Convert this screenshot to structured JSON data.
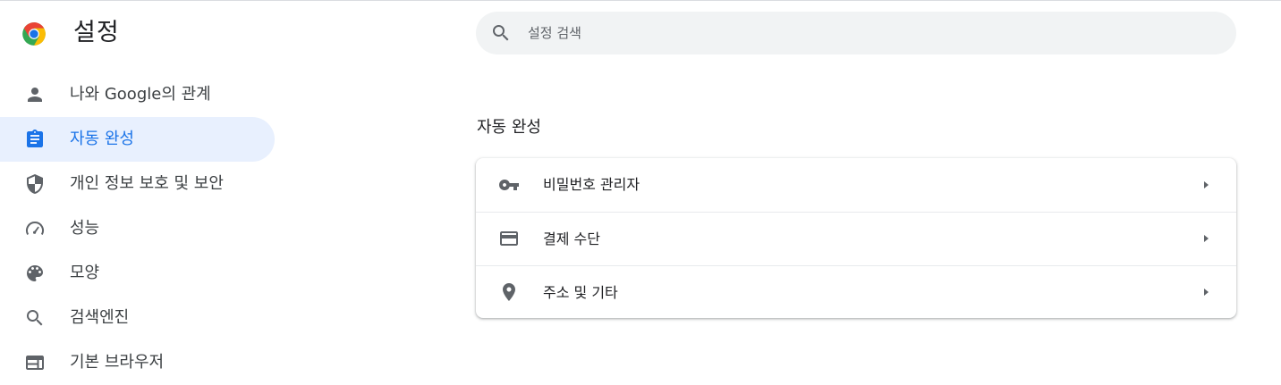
{
  "app": {
    "title": "설정",
    "logo_icon": "chrome-logo"
  },
  "search": {
    "placeholder": "설정 검색",
    "value": "",
    "icon": "search-icon"
  },
  "sidebar": {
    "items": [
      {
        "label": "나와 Google의 관계",
        "icon": "person-icon",
        "active": false
      },
      {
        "label": "자동 완성",
        "icon": "assignment-icon",
        "active": true
      },
      {
        "label": "개인 정보 보호 및 보안",
        "icon": "shield-icon",
        "active": false
      },
      {
        "label": "성능",
        "icon": "speedometer-icon",
        "active": false
      },
      {
        "label": "모양",
        "icon": "palette-icon",
        "active": false
      },
      {
        "label": "검색엔진",
        "icon": "search-icon",
        "active": false
      },
      {
        "label": "기본 브라우저",
        "icon": "browser-icon",
        "active": false
      }
    ]
  },
  "main": {
    "section_title": "자동 완성",
    "rows": [
      {
        "label": "비밀번호 관리자",
        "icon": "key-icon"
      },
      {
        "label": "결제 수단",
        "icon": "credit-card-icon"
      },
      {
        "label": "주소 및 기타",
        "icon": "location-pin-icon"
      }
    ]
  },
  "colors": {
    "accent": "#1a73e8",
    "active_background": "#e8f0fe",
    "icon_gray": "#5f6368",
    "search_background": "#f1f3f4"
  }
}
